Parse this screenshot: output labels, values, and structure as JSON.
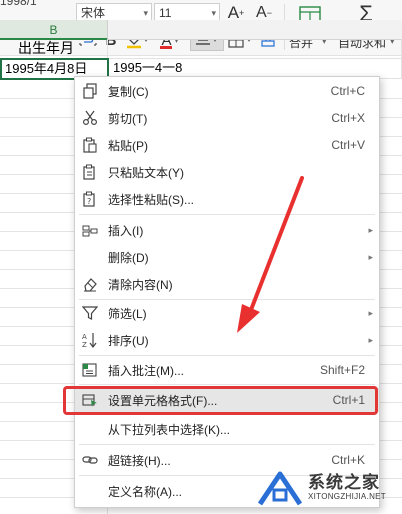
{
  "toolbar": {
    "formula_fragment": "1998/1",
    "font_name": "宋体",
    "font_size": "11",
    "increase_font_label": "A",
    "decrease_font_label": "A",
    "bold_label": "B",
    "font_color_label": "A",
    "merge_label": "合并",
    "autosum_label": "自动求和"
  },
  "sheet": {
    "column_b_header": "B",
    "cell_header_text": "出生年月",
    "cell_b_value": "1995年4月8日",
    "cell_c_value": "1995一4一8"
  },
  "context_menu": {
    "items": [
      {
        "label": "复制(C)",
        "shortcut": "Ctrl+C",
        "icon": "copy-icon"
      },
      {
        "label": "剪切(T)",
        "shortcut": "Ctrl+X",
        "icon": "scissors-icon"
      },
      {
        "label": "粘贴(P)",
        "shortcut": "Ctrl+V",
        "icon": "paste-icon"
      },
      {
        "label": "只粘贴文本(Y)",
        "icon": "paste-text-icon"
      },
      {
        "label": "选择性粘贴(S)...",
        "icon": "paste-special-icon"
      },
      {
        "label": "插入(I)",
        "icon": "insert-icon",
        "submenu": true
      },
      {
        "label": "删除(D)",
        "submenu": true
      },
      {
        "label": "清除内容(N)",
        "icon": "eraser-icon"
      },
      {
        "label": "筛选(L)",
        "icon": "filter-icon",
        "submenu": true
      },
      {
        "label": "排序(U)",
        "icon": "sort-icon",
        "submenu": true
      },
      {
        "label": "插入批注(M)...",
        "shortcut": "Shift+F2",
        "icon": "comment-icon"
      },
      {
        "label": "设置单元格格式(F)...",
        "shortcut": "Ctrl+1",
        "icon": "format-cells-icon",
        "highlighted": true
      },
      {
        "label": "从下拉列表中选择(K)..."
      },
      {
        "label": "超链接(H)...",
        "shortcut": "Ctrl+K",
        "icon": "link-icon"
      },
      {
        "label": "定义名称(A)..."
      }
    ]
  },
  "watermark": {
    "title": "系统之家",
    "subtitle": "XITONGZHIJIA.NET"
  },
  "colors": {
    "accent_green": "#217346",
    "highlight_red": "#e23737",
    "arrow_red": "#e8302f"
  }
}
